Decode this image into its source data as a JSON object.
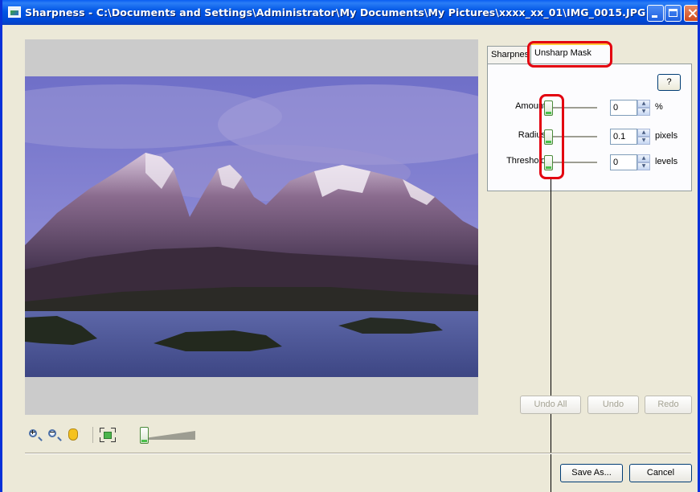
{
  "window": {
    "title": "Sharpness - C:\\Documents and Settings\\Administrator\\My Documents\\My Pictures\\xxxx_xx_01\\IMG_0015.JPG"
  },
  "tabs": [
    {
      "label": "Sharpness",
      "selected": false
    },
    {
      "label": "Unsharp Mask",
      "selected": true
    }
  ],
  "panel": {
    "help_label": "?",
    "rows": [
      {
        "label": "Amount",
        "value": "0",
        "unit": "%"
      },
      {
        "label": "Radius",
        "value": "0.1",
        "unit": "pixels"
      },
      {
        "label": "Threshold",
        "value": "0",
        "unit": "levels"
      }
    ]
  },
  "buttons": {
    "undo_all": "Undo All",
    "undo": "Undo",
    "redo": "Redo",
    "save_as": "Save As...",
    "cancel": "Cancel"
  },
  "toolbar": {
    "icons": [
      "zoom-in-icon",
      "zoom-out-icon",
      "hand-icon",
      "fit-to-window-icon"
    ],
    "zoom_level": 0
  },
  "colors": {
    "titlebar": "#0055e5",
    "highlight": "#e3000f",
    "slider_accent": "#49c04a"
  }
}
